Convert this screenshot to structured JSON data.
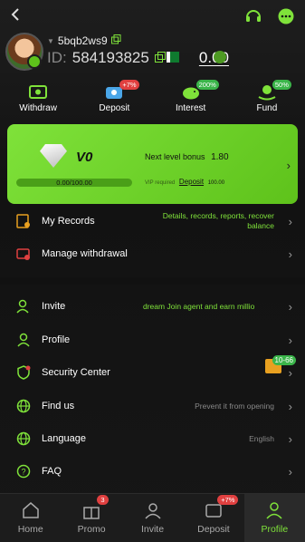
{
  "header": {
    "back_icon": "back-chevron-icon",
    "support_icon": "headset-icon",
    "chat_icon": "chat-bubble-icon"
  },
  "profile": {
    "username": "5bqb2ws9",
    "id_label": "ID:",
    "id_value": "584193825",
    "balance": "0.00"
  },
  "quick_actions": [
    {
      "label": "Withdraw",
      "badge": ""
    },
    {
      "label": "Deposit",
      "badge": "+7%"
    },
    {
      "label": "Interest",
      "badge": "200%"
    },
    {
      "label": "Fund",
      "badge": "50%"
    }
  ],
  "vip": {
    "level": "V0",
    "bonus_label": "Next level bonus",
    "bonus_value": "1.80",
    "progress_text": "0.00/100.00",
    "progress_fraction": 0.0,
    "req_label": "VIP required",
    "req_link": "Deposit",
    "req_amount": "100.00"
  },
  "menu_top": [
    {
      "label": "My Records",
      "desc": "Details, records, reports, recover balance"
    },
    {
      "label": "Manage withdrawal",
      "desc": ""
    }
  ],
  "menu_main": [
    {
      "label": "Invite",
      "desc": "dream  Join agent and earn millio"
    },
    {
      "label": "Profile",
      "desc": ""
    },
    {
      "label": "Security Center",
      "desc": ""
    },
    {
      "label": "Find us",
      "desc": "Prevent it from opening"
    },
    {
      "label": "Language",
      "desc": "English"
    },
    {
      "label": "FAQ",
      "desc": ""
    }
  ],
  "security_gift_badge": "10-66",
  "tabbar": [
    {
      "label": "Home",
      "badge": ""
    },
    {
      "label": "Promo",
      "badge": "3"
    },
    {
      "label": "Invite",
      "badge": ""
    },
    {
      "label": "Deposit",
      "badge": "+7%"
    },
    {
      "label": "Profile",
      "badge": ""
    }
  ],
  "colors": {
    "accent": "#7fe23a",
    "badge_red": "#e04040",
    "badge_green": "#3bb54a"
  }
}
